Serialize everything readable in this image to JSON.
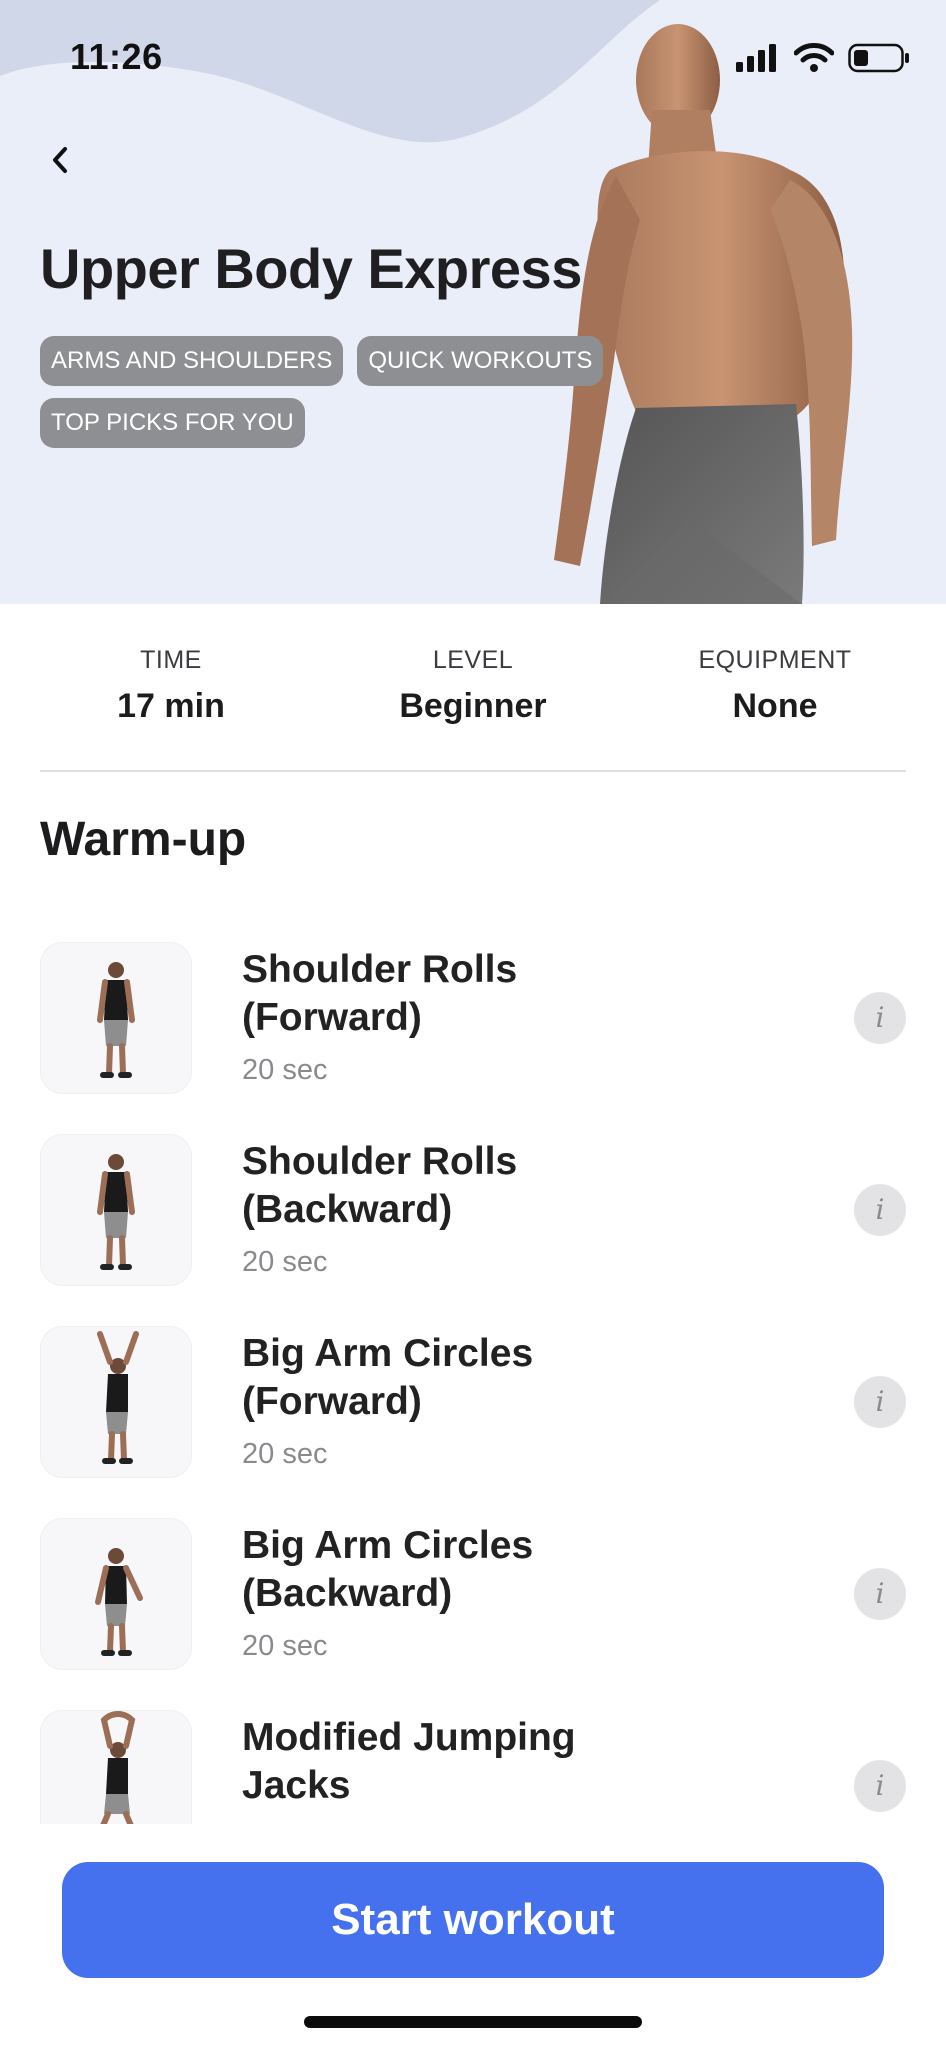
{
  "status_bar": {
    "time": "11:26",
    "icons": [
      "signal-icon",
      "wifi-icon",
      "battery-icon"
    ]
  },
  "header": {
    "back_icon": "chevron-left-icon",
    "title": "Upper Body Express",
    "tags": [
      "ARMS AND SHOULDERS",
      "QUICK WORKOUTS",
      "TOP PICKS FOR YOU"
    ]
  },
  "stats": [
    {
      "label": "TIME",
      "value": "17 min"
    },
    {
      "label": "LEVEL",
      "value": "Beginner"
    },
    {
      "label": "EQUIPMENT",
      "value": "None"
    }
  ],
  "section": {
    "title": "Warm-up"
  },
  "exercises": [
    {
      "name": "Shoulder Rolls (Forward)",
      "duration": "20 sec",
      "info_icon": "info-icon"
    },
    {
      "name": "Shoulder Rolls (Backward)",
      "duration": "20 sec",
      "info_icon": "info-icon"
    },
    {
      "name": "Big Arm Circles (Forward)",
      "duration": "20 sec",
      "info_icon": "info-icon"
    },
    {
      "name": "Big Arm Circles (Backward)",
      "duration": "20 sec",
      "info_icon": "info-icon"
    },
    {
      "name": "Modified Jumping Jacks",
      "duration": "",
      "info_icon": "info-icon"
    }
  ],
  "info_glyph": "i",
  "footer": {
    "start_label": "Start workout"
  },
  "colors": {
    "accent": "#4571ee",
    "hero_background": "#e9eef8",
    "tag_background": "#8e8f93"
  }
}
